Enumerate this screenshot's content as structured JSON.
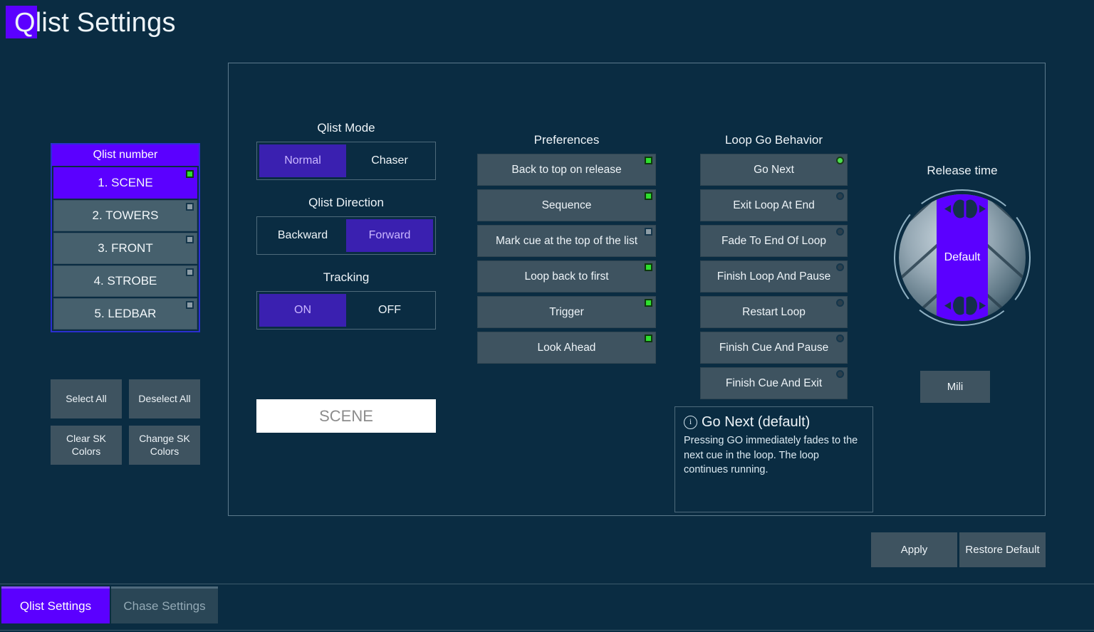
{
  "window": {
    "title_accent_letter": "Q",
    "title": "list Settings",
    "accent_color": "#5b00ff",
    "background_color": "#0a2c42"
  },
  "qlist_panel": {
    "header": "Qlist number",
    "items": [
      {
        "label": "1. SCENE",
        "selected": true,
        "indicator": "on"
      },
      {
        "label": "2. TOWERS",
        "selected": false,
        "indicator": "off"
      },
      {
        "label": "3. FRONT",
        "selected": false,
        "indicator": "off"
      },
      {
        "label": "4. STROBE",
        "selected": false,
        "indicator": "off"
      },
      {
        "label": "5. LEDBAR",
        "selected": false,
        "indicator": "off"
      }
    ]
  },
  "side_buttons": [
    {
      "label": "Select All"
    },
    {
      "label": "Deselect All"
    },
    {
      "label": "Clear SK Colors"
    },
    {
      "label": "Change SK Colors"
    }
  ],
  "toggles": [
    {
      "title": "Qlist Mode",
      "options": [
        {
          "label": "Normal",
          "active": true
        },
        {
          "label": "Chaser",
          "active": false
        }
      ]
    },
    {
      "title": "Qlist Direction",
      "options": [
        {
          "label": "Backward",
          "active": false
        },
        {
          "label": "Forward",
          "active": true
        }
      ]
    },
    {
      "title": "Tracking",
      "options": [
        {
          "label": "ON",
          "active": true
        },
        {
          "label": "OFF",
          "active": false
        }
      ]
    }
  ],
  "name_field": {
    "value": "SCENE"
  },
  "preferences": {
    "title": "Preferences",
    "items": [
      {
        "label": "Back to top on release",
        "indicator": "on"
      },
      {
        "label": "Sequence",
        "indicator": "on"
      },
      {
        "label": "Mark cue at the top of the list",
        "indicator": "off"
      },
      {
        "label": "Loop back to first",
        "indicator": "on"
      },
      {
        "label": "Trigger",
        "indicator": "on"
      },
      {
        "label": "Look Ahead",
        "indicator": "on"
      }
    ]
  },
  "loop_go_behavior": {
    "title": "Loop Go Behavior",
    "items": [
      {
        "label": "Go Next",
        "selected": true
      },
      {
        "label": "Exit Loop At End",
        "selected": false
      },
      {
        "label": "Fade To End Of Loop",
        "selected": false
      },
      {
        "label": "Finish Loop And Pause",
        "selected": false
      },
      {
        "label": "Restart Loop",
        "selected": false
      },
      {
        "label": "Finish Cue And Pause",
        "selected": false
      },
      {
        "label": "Finish Cue And Exit",
        "selected": false
      }
    ]
  },
  "info_box": {
    "icon": "info-icon",
    "heading": "Go Next (default)",
    "body": "Pressing GO immediately fades to the next cue in the loop. The loop continues running."
  },
  "release_time": {
    "title": "Release time",
    "value": "Default",
    "unit_button": "Mili"
  },
  "actions": {
    "apply": "Apply",
    "restore_default": "Restore Default"
  },
  "tabs": [
    {
      "label": "Qlist Settings",
      "active": true
    },
    {
      "label": "Chase Settings",
      "active": false
    }
  ]
}
